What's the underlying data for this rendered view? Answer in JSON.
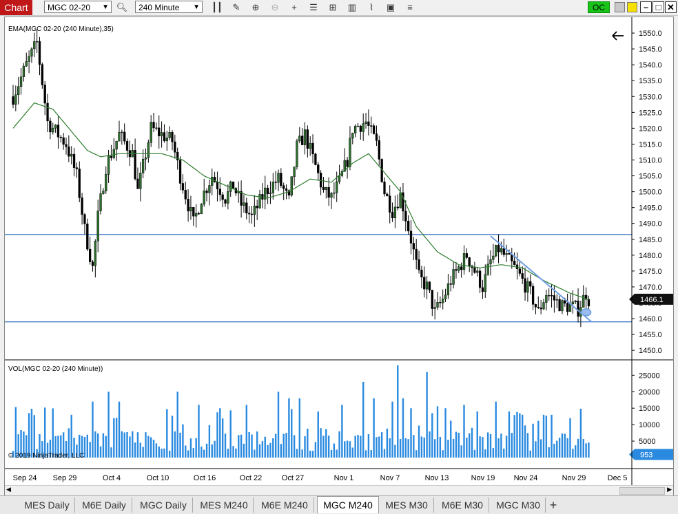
{
  "toolbar": {
    "chart_label": "Chart",
    "instrument": "MGC 02-20",
    "interval": "240 Minute",
    "oc_label": "OC"
  },
  "chart_data": [
    {
      "type": "candlestick",
      "title": "EMA(MGC 02-20 (240 Minute),35)",
      "ylim": [
        1447,
        1555
      ],
      "y_ticks": [
        1450.0,
        1455.0,
        1460.0,
        1465.0,
        1470.0,
        1475.0,
        1480.0,
        1485.0,
        1490.0,
        1495.0,
        1500.0,
        1505.0,
        1510.0,
        1515.0,
        1520.0,
        1525.0,
        1530.0,
        1535.0,
        1540.0,
        1545.0,
        1550.0
      ],
      "last_price": "1466.1",
      "horizontal_lines": [
        1486.5,
        1459.0
      ],
      "close_anchors": [
        [
          0,
          1530
        ],
        [
          5,
          1540
        ],
        [
          9,
          1547
        ],
        [
          13,
          1522
        ],
        [
          20,
          1515
        ],
        [
          24,
          1505
        ],
        [
          27,
          1488
        ],
        [
          30,
          1476
        ],
        [
          32,
          1492
        ],
        [
          35,
          1508
        ],
        [
          40,
          1518
        ],
        [
          45,
          1512
        ],
        [
          47,
          1500
        ],
        [
          52,
          1520
        ],
        [
          60,
          1516
        ],
        [
          63,
          1505
        ],
        [
          66,
          1496
        ],
        [
          68,
          1490
        ],
        [
          71,
          1498
        ],
        [
          75,
          1505
        ],
        [
          80,
          1498
        ],
        [
          83,
          1502
        ],
        [
          86,
          1496
        ],
        [
          90,
          1492
        ],
        [
          95,
          1500
        ],
        [
          100,
          1504
        ],
        [
          104,
          1497
        ],
        [
          107,
          1514
        ],
        [
          110,
          1518
        ],
        [
          114,
          1508
        ],
        [
          117,
          1500
        ],
        [
          120,
          1498
        ],
        [
          123,
          1503
        ],
        [
          126,
          1510
        ],
        [
          128,
          1520
        ],
        [
          133,
          1522
        ],
        [
          137,
          1515
        ],
        [
          140,
          1500
        ],
        [
          143,
          1494
        ],
        [
          146,
          1499
        ],
        [
          150,
          1485
        ],
        [
          153,
          1473
        ],
        [
          156,
          1470
        ],
        [
          159,
          1462
        ],
        [
          162,
          1466
        ],
        [
          165,
          1472
        ],
        [
          168,
          1476
        ],
        [
          171,
          1480
        ],
        [
          174,
          1475
        ],
        [
          177,
          1470
        ],
        [
          180,
          1478
        ],
        [
          183,
          1482
        ],
        [
          186,
          1479
        ],
        [
          189,
          1476
        ],
        [
          192,
          1472
        ],
        [
          195,
          1468
        ],
        [
          198,
          1462
        ],
        [
          201,
          1468
        ],
        [
          204,
          1466
        ],
        [
          207,
          1464
        ],
        [
          210,
          1464
        ],
        [
          213,
          1463
        ],
        [
          216,
          1468
        ],
        [
          217,
          1466
        ]
      ],
      "ema_anchors": [
        [
          0,
          1520
        ],
        [
          8,
          1528
        ],
        [
          15,
          1526
        ],
        [
          22,
          1519
        ],
        [
          28,
          1513
        ],
        [
          33,
          1511
        ],
        [
          40,
          1512
        ],
        [
          48,
          1512
        ],
        [
          56,
          1512
        ],
        [
          64,
          1510
        ],
        [
          72,
          1505
        ],
        [
          80,
          1502
        ],
        [
          88,
          1499
        ],
        [
          96,
          1498
        ],
        [
          104,
          1500
        ],
        [
          112,
          1504
        ],
        [
          120,
          1503
        ],
        [
          128,
          1509
        ],
        [
          134,
          1512
        ],
        [
          140,
          1506
        ],
        [
          146,
          1500
        ],
        [
          152,
          1489
        ],
        [
          160,
          1481
        ],
        [
          168,
          1477
        ],
        [
          176,
          1476
        ],
        [
          184,
          1477
        ],
        [
          192,
          1476
        ],
        [
          200,
          1472
        ],
        [
          210,
          1468
        ],
        [
          217,
          1466
        ]
      ]
    },
    {
      "type": "bar",
      "title": "VOL(MGC 02-20 (240 Minute))",
      "ylim": [
        0,
        28000
      ],
      "y_ticks": [
        5000,
        10000,
        15000,
        20000,
        25000
      ],
      "last_value": "953",
      "peaks": [
        [
          22,
          13000
        ],
        [
          30,
          17000
        ],
        [
          36,
          20000
        ],
        [
          40,
          17000
        ],
        [
          62,
          20000
        ],
        [
          70,
          16000
        ],
        [
          78,
          15000
        ],
        [
          88,
          16000
        ],
        [
          100,
          20000
        ],
        [
          104,
          18000
        ],
        [
          108,
          18000
        ],
        [
          115,
          14000
        ],
        [
          124,
          16000
        ],
        [
          132,
          23000
        ],
        [
          136,
          18000
        ],
        [
          143,
          17000
        ],
        [
          145,
          28000
        ],
        [
          147,
          18000
        ],
        [
          150,
          15000
        ],
        [
          156,
          26000
        ],
        [
          163,
          15000
        ],
        [
          170,
          16000
        ],
        [
          175,
          14000
        ],
        [
          182,
          17000
        ],
        [
          187,
          14000
        ],
        [
          192,
          13000
        ],
        [
          200,
          13000
        ],
        [
          210,
          12000
        ]
      ]
    }
  ],
  "x_axis_labels": [
    "Sep 24",
    "Sep 29",
    "Oct 4",
    "Oct 10",
    "Oct 16",
    "Oct 22",
    "Oct 27",
    "Nov 1",
    "Nov 7",
    "Nov 13",
    "Nov 19",
    "Nov 24",
    "Nov 29",
    "Dec 5"
  ],
  "copyright": "© 2019 NinjaTrader, LLC",
  "tabs": [
    {
      "label": "MES  Daily",
      "active": false
    },
    {
      "label": "M6E  Daily",
      "active": false
    },
    {
      "label": "MGC  Daily",
      "active": false
    },
    {
      "label": "MES  M240",
      "active": false
    },
    {
      "label": "M6E  M240",
      "active": false
    },
    {
      "label": "MGC  M240",
      "active": true
    },
    {
      "label": "MES  M30",
      "active": false
    },
    {
      "label": "M6E  M30",
      "active": false
    },
    {
      "label": "MGC M30",
      "active": false
    }
  ],
  "add_tab_label": "+",
  "colors": {
    "up": "#1a1a1a",
    "ema": "#2e7d2e",
    "hline": "#4a7ec8",
    "trend": "#6f9de0",
    "volume": "#2a8ae0",
    "last_price_bg": "#111111",
    "last_vol_bg": "#2a8ae0"
  }
}
